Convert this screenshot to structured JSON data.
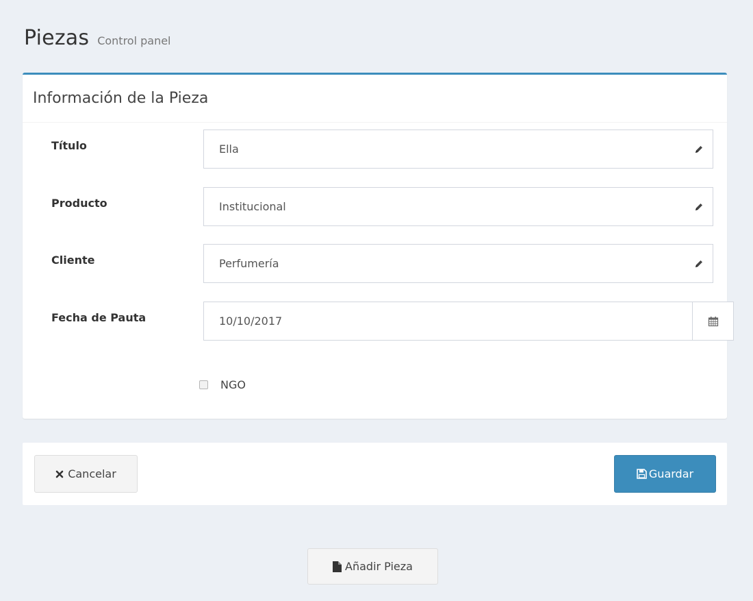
{
  "header": {
    "title": "Piezas",
    "subtitle": "Control panel"
  },
  "box": {
    "title": "Información de la Pieza"
  },
  "fields": {
    "titulo": {
      "label": "Título",
      "value": "Ella",
      "icon": "pencil-icon"
    },
    "producto": {
      "label": "Producto",
      "value": "Institucional",
      "icon": "pencil-icon"
    },
    "cliente": {
      "label": "Cliente",
      "value": "Perfumería",
      "icon": "pencil-icon"
    },
    "fecha": {
      "label": "Fecha de Pauta",
      "value": "10/10/2017",
      "icon": "calendar-icon"
    }
  },
  "checkbox": {
    "label": "NGO",
    "checked": false
  },
  "buttons": {
    "cancel": {
      "label": "Cancelar",
      "icon": "times-icon"
    },
    "save": {
      "label": "Guardar",
      "icon": "floppy-icon"
    },
    "add": {
      "label": "Añadir Pieza",
      "icon": "file-icon"
    }
  },
  "colors": {
    "accent": "#3c8dbc",
    "background": "#ecf0f5"
  }
}
